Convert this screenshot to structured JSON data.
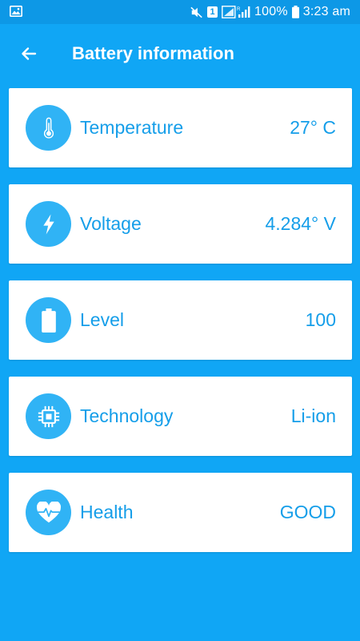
{
  "status_bar": {
    "battery_percent": "100%",
    "time": "3:23 am",
    "sim_slot": "1",
    "icons": [
      "image-icon",
      "mute-icon",
      "sim-icon",
      "signal-icon",
      "battery-icon"
    ]
  },
  "header": {
    "title": "Battery information",
    "back_icon": "arrow-left-icon"
  },
  "items": [
    {
      "icon": "thermometer-icon",
      "label": "Temperature",
      "value": "27° C"
    },
    {
      "icon": "lightning-icon",
      "label": "Voltage",
      "value": "4.284° V"
    },
    {
      "icon": "battery-level-icon",
      "label": "Level",
      "value": "100"
    },
    {
      "icon": "chip-icon",
      "label": "Technology",
      "value": "Li-ion"
    },
    {
      "icon": "heart-pulse-icon",
      "label": "Health",
      "value": "GOOD"
    }
  ],
  "colors": {
    "background": "#10a6f5",
    "status_bar": "#0d98e6",
    "card": "#ffffff",
    "accent_text": "#159ee9",
    "icon_circle": "#30b3f5"
  }
}
